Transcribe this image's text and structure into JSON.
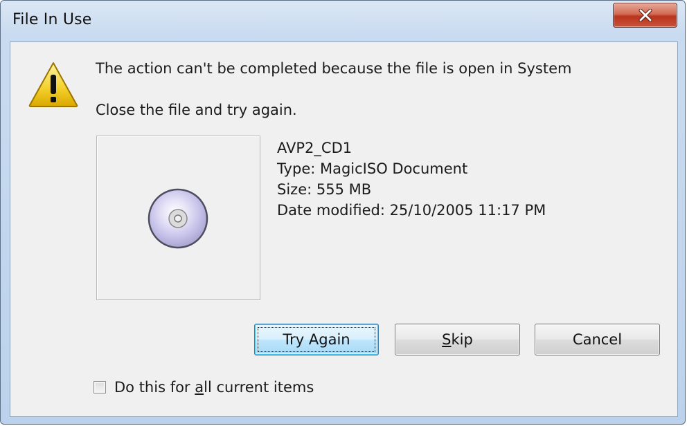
{
  "window": {
    "title": "File In Use"
  },
  "message": {
    "line1": "The action can't be completed because the file is open in System",
    "line2": "Close the file and try again."
  },
  "file": {
    "name": "AVP2_CD1",
    "type": "Type: MagicISO Document",
    "size": "Size: 555 MB",
    "date_modified": "Date modified: 25/10/2005 11:17 PM",
    "icon": "disc-icon"
  },
  "buttons": {
    "try_again": "Try Again",
    "skip_rest": "kip",
    "skip_key": "S",
    "cancel": "Cancel"
  },
  "checkbox": {
    "label_prefix": "Do this for ",
    "label_key": "a",
    "label_suffix": "ll current items",
    "checked": false
  },
  "icons": {
    "warning": "warning-icon",
    "close": "close-icon"
  },
  "colors": {
    "close_button": "#c8513a",
    "default_button_border": "#3c7fb1"
  }
}
